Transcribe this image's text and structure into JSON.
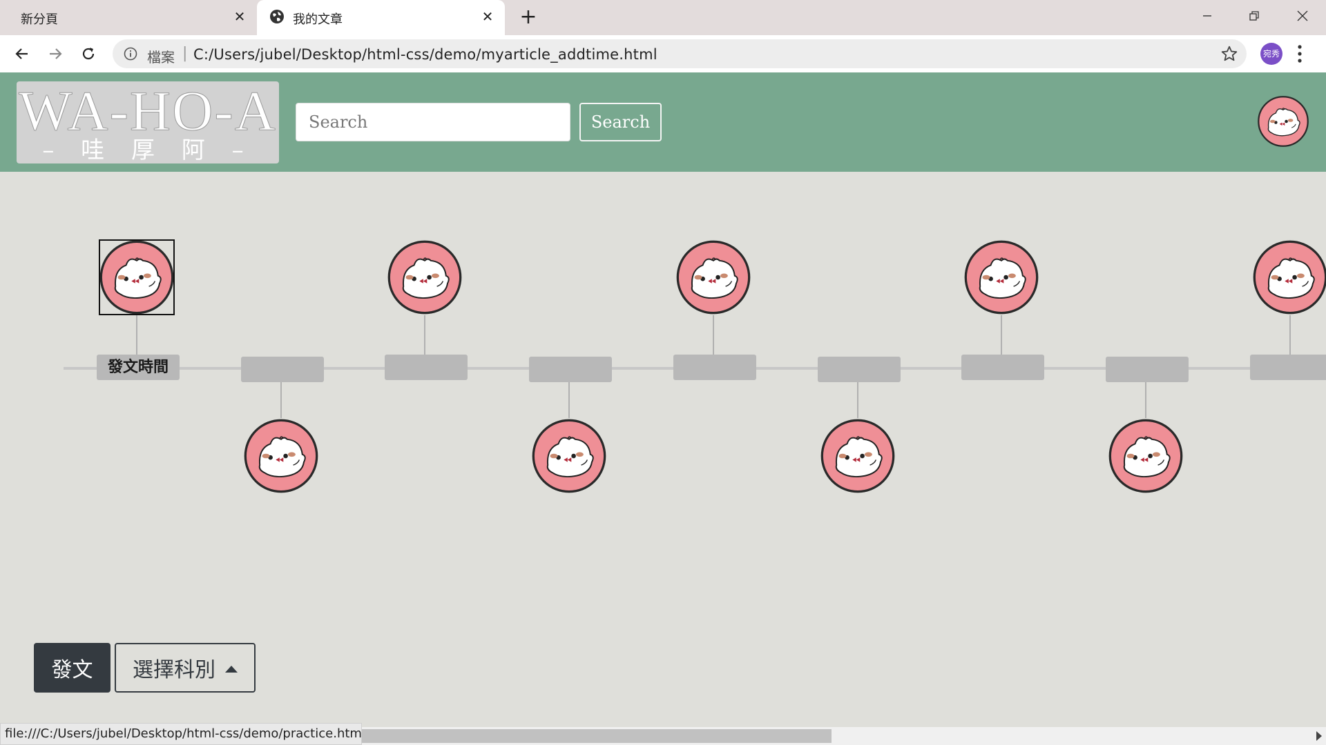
{
  "browser": {
    "tabs": [
      {
        "title": "新分頁",
        "active": false
      },
      {
        "title": "我的文章",
        "active": true
      }
    ],
    "address": {
      "scheme_label": "檔案",
      "url": "C:/Users/jubel/Desktop/html-css/demo/myarticle_addtime.html"
    },
    "profile_label": "宛秀",
    "status_url": "file:///C:/Users/jubel/Desktop/html-css/demo/practice.html"
  },
  "header": {
    "logo_main": "WA-HO-A",
    "logo_sub": "– 哇 厚 阿 –",
    "search_placeholder": "Search",
    "search_button": "Search",
    "colors": {
      "header_bg": "#78a88f",
      "page_bg": "#dfdfda",
      "avatar_pink": "#ef8f96"
    }
  },
  "timeline": {
    "first_label": "發文時間",
    "post_count": 9
  },
  "actions": {
    "post_label": "發文",
    "category_label": "選擇科別"
  }
}
